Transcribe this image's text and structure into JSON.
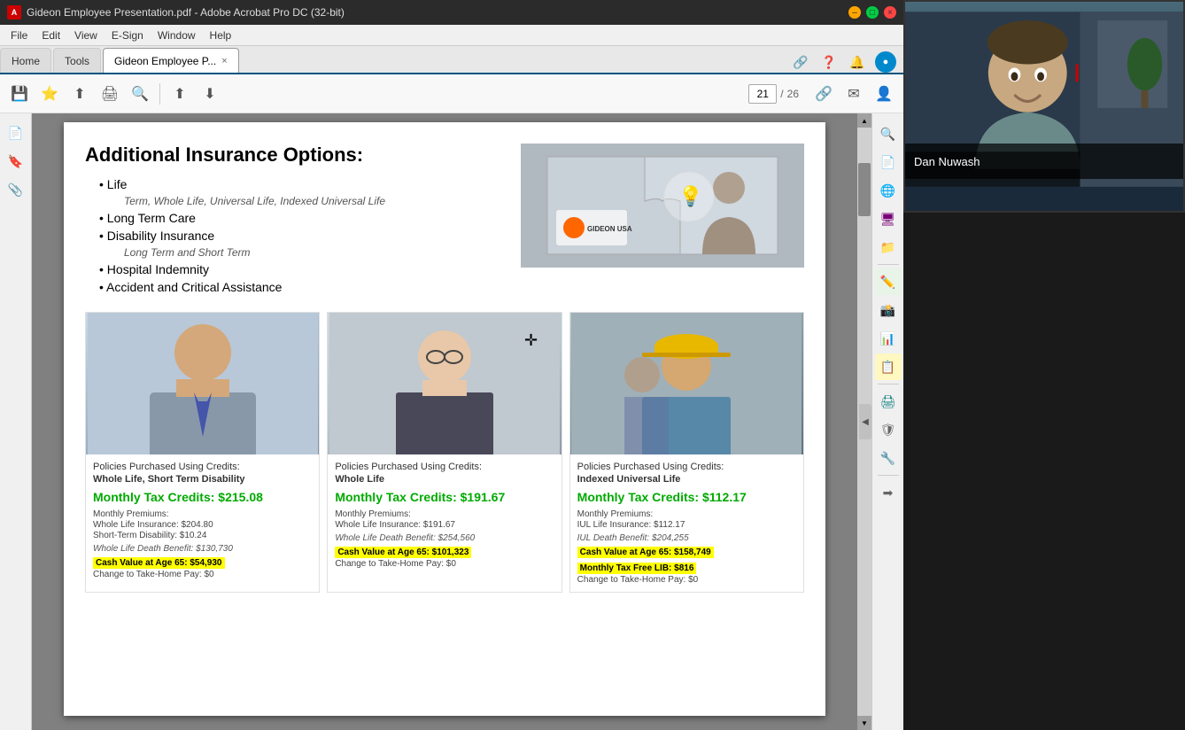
{
  "window": {
    "title": "Gideon Employee Presentation.pdf - Adobe Acrobat Pro DC (32-bit)",
    "app_icon": "A"
  },
  "menu": {
    "items": [
      "File",
      "Edit",
      "View",
      "E-Sign",
      "Window",
      "Help"
    ]
  },
  "tabs": {
    "home": "Home",
    "tools": "Tools",
    "active_tab": "Gideon Employee P...",
    "close_icon": "×"
  },
  "toolbar": {
    "page_current": "21",
    "page_total": "26",
    "page_separator": "/"
  },
  "pdf": {
    "heading": "Additional Insurance Options:",
    "bullets": [
      {
        "text": "Life",
        "sub": "Term, Whole Life, Universal Life, Indexed Universal Life"
      },
      {
        "text": "Long Term Care",
        "sub": null
      },
      {
        "text": "Disability Insurance",
        "sub": "Long Term and Short Term"
      },
      {
        "text": "Hospital Indemnity",
        "sub": null
      },
      {
        "text": "Accident and Critical Assistance",
        "sub": null
      }
    ],
    "cards": [
      {
        "policies_label": "Policies Purchased Using Credits:",
        "policies_type": "Whole Life, Short Term Disability",
        "credits_label": "Monthly Tax Credits: $215.08",
        "premiums_label": "Monthly Premiums:",
        "premiums_items": [
          "Whole Life Insurance: $204.80",
          "Short-Term Disability: $10.24"
        ],
        "benefit_label": "Whole Life Death Benefit: $130,730",
        "cash_val": "Cash Value at Age 65: $54,930",
        "change": "Change to Take-Home Pay: $0"
      },
      {
        "policies_label": "Policies Purchased Using Credits:",
        "policies_type": "Whole Life",
        "credits_label": "Monthly Tax Credits: $191.67",
        "premiums_label": "Monthly Premiums:",
        "premiums_items": [
          "Whole Life Insurance: $191.67"
        ],
        "benefit_label": "Whole Life Death Benefit: $254,560",
        "cash_val": "Cash Value at Age 65: $101,323",
        "change": "Change to Take-Home Pay: $0"
      },
      {
        "policies_label": "Policies Purchased Using Credits:",
        "policies_type": "Indexed Universal Life",
        "credits_label": "Monthly Tax Credits: $112.17",
        "premiums_label": "Monthly Premiums:",
        "premiums_items": [
          "IUL Life Insurance: $112.17"
        ],
        "benefit_label": "IUL Death Benefit: $204,255",
        "cash_val": "Cash Value at Age 65: $158,749",
        "cash_val2": "Monthly Tax Free LIB: $816",
        "change": "Change to Take-Home Pay: $0"
      }
    ]
  },
  "webcam": {
    "name": "Dan Nuwash"
  },
  "right_toolbar": {
    "icons": [
      "🔍",
      "📄",
      "🌐",
      "🖥",
      "📁",
      "✏️",
      "📸",
      "📊",
      "📋",
      "🖨",
      "🛡",
      "🔧",
      "➡"
    ]
  }
}
